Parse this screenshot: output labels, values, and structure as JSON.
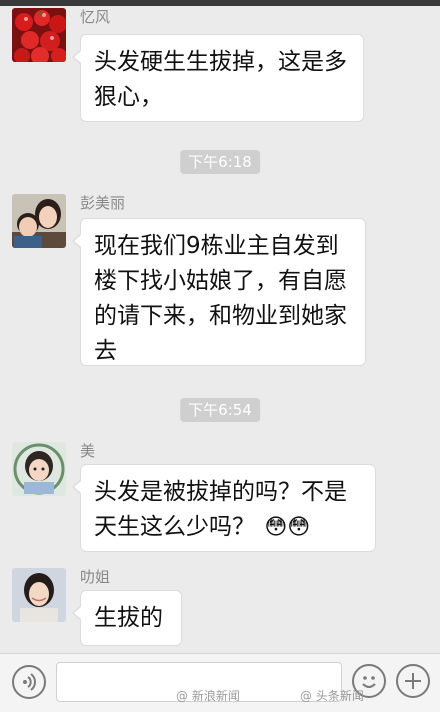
{
  "messages": [
    {
      "sender": "忆风",
      "text": "头发硬生生拔掉，这是多狠心，",
      "avatar": "fruit-avatar"
    },
    {
      "sender": "彭美丽",
      "text": "现在我们9栋业主自发到楼下找小姑娘了，有自愿的请下来，和物业到她家去",
      "avatar": "mother-child-avatar"
    },
    {
      "sender": "美",
      "text": "头发是被拔掉的吗？不是天生这么少吗？",
      "emoji": "😳😳",
      "avatar": "child-avatar"
    },
    {
      "sender": "叻姐",
      "text": "生拔的",
      "avatar": "woman-avatar"
    }
  ],
  "timestamps": [
    "下午6:18",
    "下午6:54"
  ],
  "watermarks": [
    "@ 新浪新闻",
    "@ 头条新闻"
  ],
  "colors": {
    "background": "#ebebeb",
    "bubble": "#ffffff",
    "timestamp_bg": "#cfcfcf"
  }
}
